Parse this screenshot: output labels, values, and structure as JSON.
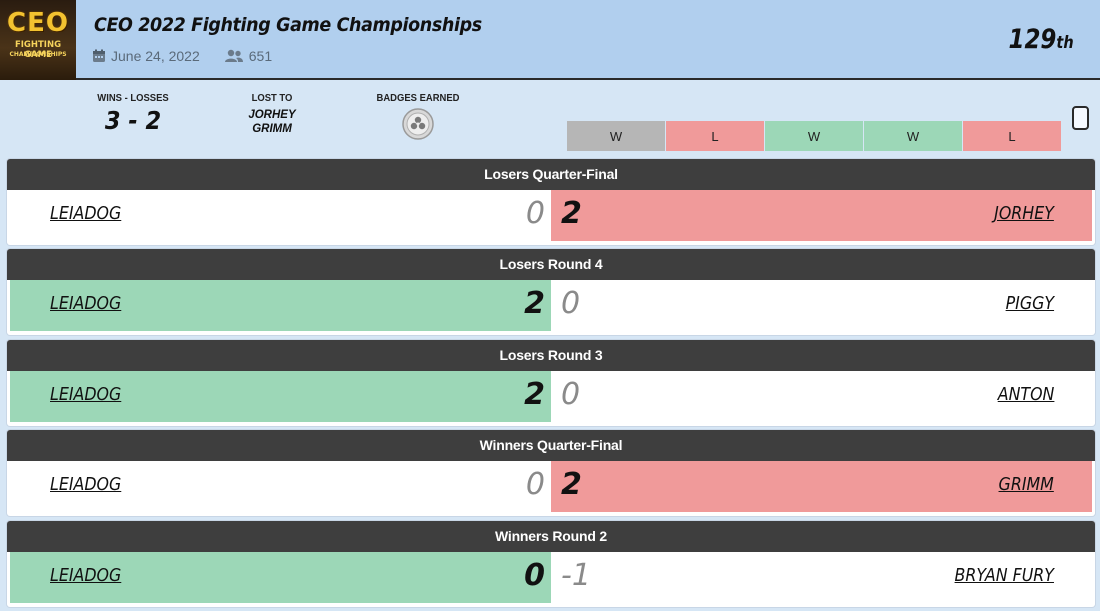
{
  "event": {
    "logo_main": "CEO",
    "logo_sub": "FIGHTING GAME",
    "logo_sub2": "CHAMPIONSHIPS",
    "title": "CEO 2022 Fighting Game Championships",
    "date": "June 24, 2022",
    "entrants": "651",
    "placement": "129",
    "placement_suffix": "th",
    "icons": {
      "date": "calendar-icon",
      "entrants": "people-icon"
    }
  },
  "summary": {
    "wl_label": "WINS - LOSSES",
    "wl_value": "3 - 2",
    "lost_to_label": "LOST TO",
    "lost_to": [
      "JORHEY",
      "GRIMM"
    ],
    "badges_label": "BADGES EARNED",
    "badge_icon": "badge-coin-icon",
    "results": [
      "W",
      "L",
      "W",
      "W",
      "L"
    ],
    "result_colors": {
      "W": "#9cd7b7",
      "L": "#f09a9a",
      "first": "#b6b6b6"
    }
  },
  "matches": [
    {
      "round": "Losers Quarter-Final",
      "p1": "LEIADOG",
      "p1_score": "0",
      "p2_score": "2",
      "p2": "JORHEY",
      "p1_state": "none",
      "p2_state": "loss"
    },
    {
      "round": "Losers Round 4",
      "p1": "LEIADOG",
      "p1_score": "2",
      "p2_score": "0",
      "p2": "PIGGY",
      "p1_state": "win",
      "p2_state": "none"
    },
    {
      "round": "Losers Round 3",
      "p1": "LEIADOG",
      "p1_score": "2",
      "p2_score": "0",
      "p2": "ANTON",
      "p1_state": "win",
      "p2_state": "none"
    },
    {
      "round": "Winners Quarter-Final",
      "p1": "LEIADOG",
      "p1_score": "0",
      "p2_score": "2",
      "p2": "GRIMM",
      "p1_state": "none",
      "p2_state": "loss"
    },
    {
      "round": "Winners Round 2",
      "p1": "LEIADOG",
      "p1_score": "0",
      "p2_score": "-1",
      "p2": "BRYAN FURY",
      "p1_state": "win",
      "p2_state": "none"
    }
  ],
  "colors": {
    "header_bg": "#b1cfee",
    "page_bg": "#d6e6f5",
    "win": "#9cd7b7",
    "loss": "#f09a9a",
    "round_bar": "#3e3e3e"
  }
}
